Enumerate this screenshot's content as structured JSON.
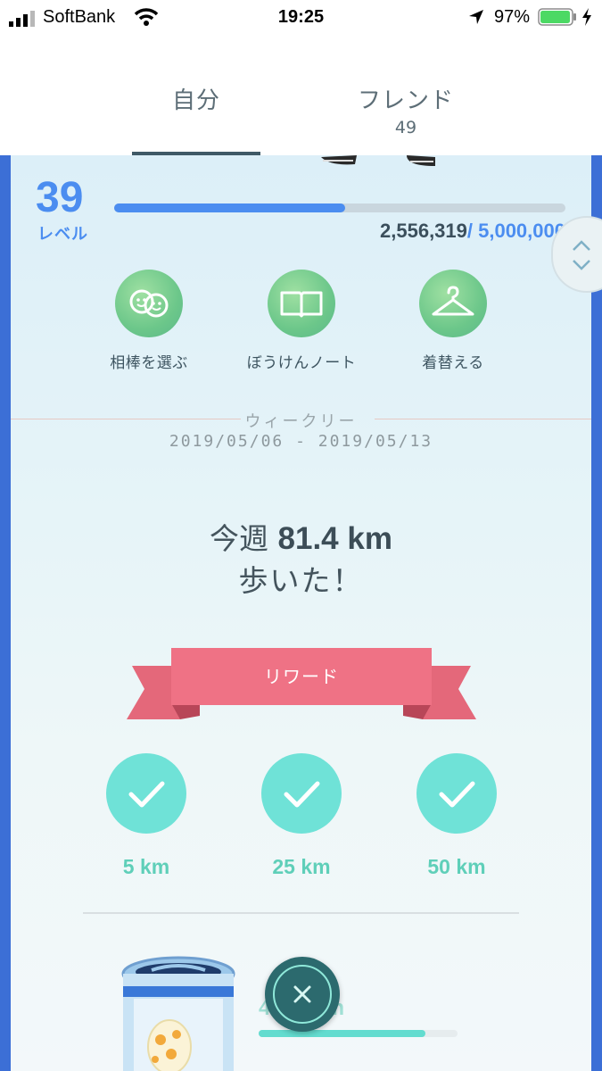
{
  "status_bar": {
    "carrier": "SoftBank",
    "time": "19:25",
    "battery_percent": "97%",
    "battery_level": 0.97
  },
  "tabs": {
    "self_label": "自分",
    "friend_label": "フレンド",
    "friend_count": "49"
  },
  "level": {
    "number": "39",
    "label": "レベル",
    "xp_current": "2,556,319",
    "xp_max": "/ 5,000,000",
    "xp_fraction": 0.511
  },
  "actions": [
    {
      "label": "相棒を選ぶ",
      "icon": "buddy-icon"
    },
    {
      "label": "ぼうけんノート",
      "icon": "journal-icon"
    },
    {
      "label": "着替える",
      "icon": "hanger-icon"
    }
  ],
  "weekly": {
    "title": "ウィークリー",
    "range": "2019/05/06 - 2019/05/13",
    "walk_prefix": "今週 ",
    "walk_distance": "81.4 km",
    "walk_suffix": "歩いた！"
  },
  "reward": {
    "label": "リワード",
    "milestones": [
      {
        "label": "5 km",
        "completed": true
      },
      {
        "label": "25 km",
        "completed": true
      },
      {
        "label": "50 km",
        "completed": true
      }
    ]
  },
  "egg": {
    "progress_text_left": "4",
    "progress_text_right": "km",
    "progress_fraction": 0.84
  },
  "colors": {
    "accent_blue": "#4b8df0",
    "teal": "#6fe2d7",
    "ribbon": "#ea6b7e",
    "action_green": "#6cc78a"
  }
}
